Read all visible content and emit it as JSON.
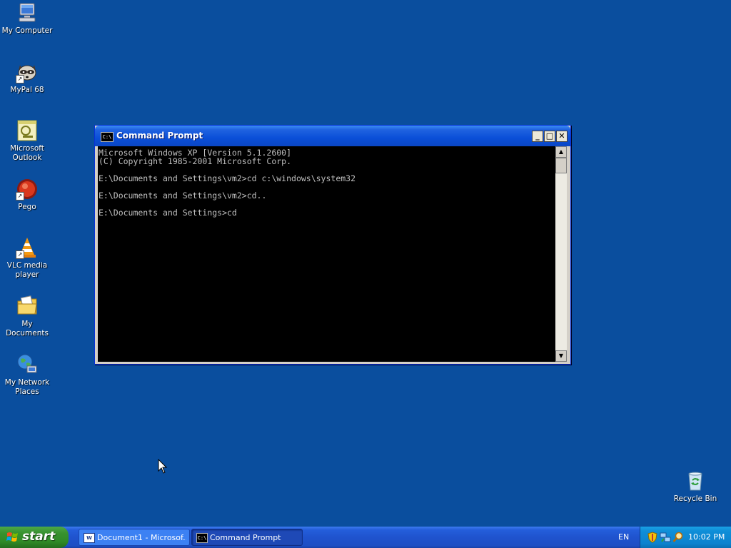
{
  "desktop": {
    "icons": [
      {
        "name": "my-computer",
        "label": "My Computer",
        "icon": "computer-icon"
      },
      {
        "name": "mypal-68",
        "label": "MyPal 68",
        "icon": "raccoon-icon"
      },
      {
        "name": "microsoft-outlook",
        "label": "Microsoft\nOutlook",
        "icon": "outlook-icon"
      },
      {
        "name": "pego",
        "label": "Pego",
        "icon": "pego-icon"
      },
      {
        "name": "vlc-media-player",
        "label": "VLC media\nplayer",
        "icon": "vlc-cone-icon"
      },
      {
        "name": "my-documents",
        "label": "My Documents",
        "icon": "folder-icon"
      },
      {
        "name": "my-network-places",
        "label": "My Network\nPlaces",
        "icon": "network-globe-icon"
      },
      {
        "name": "recycle-bin",
        "label": "Recycle Bin",
        "icon": "recycle-bin-icon"
      }
    ]
  },
  "window": {
    "title": "Command Prompt",
    "icon_text": "C:\\",
    "minimize": "_",
    "maximize": "□",
    "close": "✕",
    "console_text": "Microsoft Windows XP [Version 5.1.2600]\n(C) Copyright 1985-2001 Microsoft Corp.\n\nE:\\Documents and Settings\\vm2>cd c:\\windows\\system32\n\nE:\\Documents and Settings\\vm2>cd..\n\nE:\\Documents and Settings>cd",
    "scroll_up": "▲",
    "scroll_down": "▼"
  },
  "taskbar": {
    "start_label": "start",
    "tasks": [
      {
        "label": "Document1 - Microsof...",
        "icon_text": "W",
        "icon": "word-icon",
        "active": false
      },
      {
        "label": "Command Prompt",
        "icon_text": "C:\\",
        "icon": "cmd-icon",
        "active": true
      }
    ],
    "language": "EN",
    "clock": "10:02 PM"
  },
  "colors": {
    "desktop": "#0A4E9E",
    "titlebar": "#0A4FD8",
    "taskbar": "#245EDB",
    "start": "#38922F",
    "tray": "#0F8ED8",
    "console_bg": "#000000",
    "console_fg": "#C0C0C0"
  }
}
